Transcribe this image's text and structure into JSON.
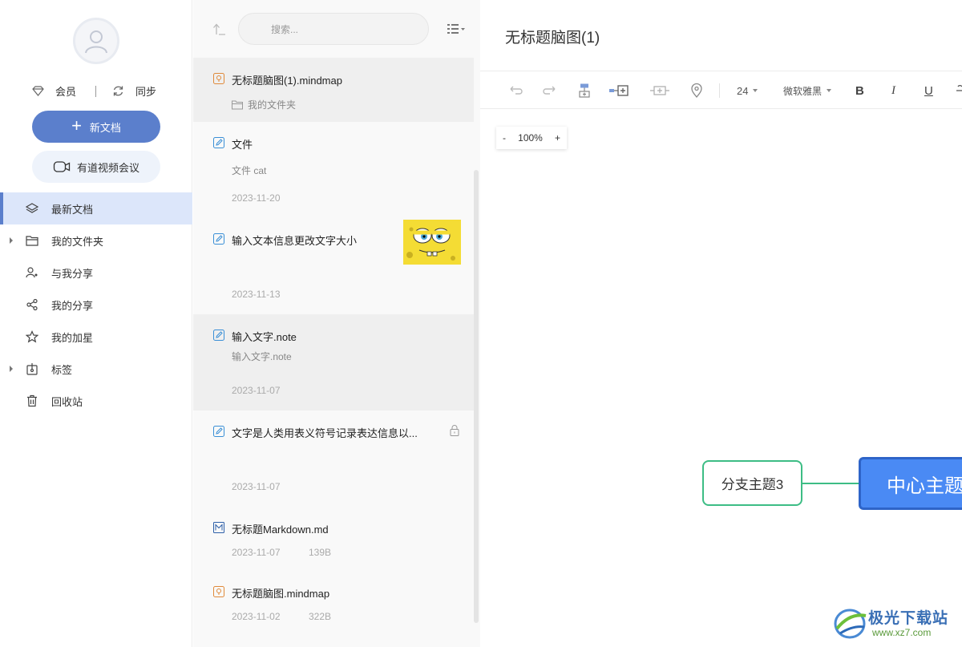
{
  "sidebar": {
    "member_label": "会员",
    "sync_label": "同步",
    "new_doc_label": "新文档",
    "meeting_label": "有道视频会议",
    "nav": [
      {
        "label": "最新文档",
        "icon": "layers-icon"
      },
      {
        "label": "我的文件夹",
        "icon": "folder-icon"
      },
      {
        "label": "与我分享",
        "icon": "shared-with-me-icon"
      },
      {
        "label": "我的分享",
        "icon": "share-icon"
      },
      {
        "label": "我的加星",
        "icon": "star-icon"
      },
      {
        "label": "标签",
        "icon": "tag-icon"
      },
      {
        "label": "回收站",
        "icon": "trash-icon"
      }
    ]
  },
  "list": {
    "search_placeholder": "搜索...",
    "files": [
      {
        "name": "无标题脑图(1).mindmap",
        "sub": "我的文件夹",
        "type": "mindmap"
      },
      {
        "name": "文件",
        "sub": "文件 cat",
        "date": "2023-11-20",
        "type": "note"
      },
      {
        "name": "输入文本信息更改文字大小",
        "date": "2023-11-13",
        "type": "note"
      },
      {
        "name": "输入文字.note",
        "sub": "输入文字.note",
        "date": "2023-11-07",
        "type": "note"
      },
      {
        "name": "文字是人类用表义符号记录表达信息以...",
        "date": "2023-11-07",
        "type": "note"
      },
      {
        "name": "无标题Markdown.md",
        "date": "2023-11-07",
        "size": "139B",
        "type": "markdown"
      },
      {
        "name": "无标题脑图.mindmap",
        "date": "2023-11-02",
        "size": "322B",
        "type": "mindmap"
      }
    ]
  },
  "editor": {
    "title": "无标题脑图(1)",
    "font_size": "24",
    "font_family": "微软雅黑",
    "bold": "B",
    "italic": "I",
    "underline": "U",
    "zoom": {
      "minus": "-",
      "value": "100%",
      "plus": "+"
    },
    "branch_topic": "分支主题3",
    "central_topic": "中心主题"
  },
  "watermark": {
    "name": "极光下载站",
    "url": "www.xz7.com"
  },
  "colors": {
    "accent": "#5b7fcc",
    "branch_border": "#3dbd85",
    "central_fill": "#4a8af4"
  }
}
